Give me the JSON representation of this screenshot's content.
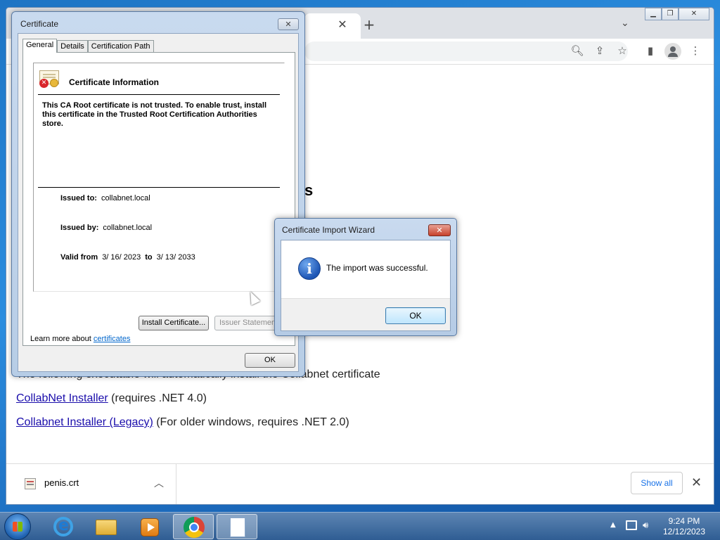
{
  "browser": {
    "page_heading_fragment": "s",
    "lines": {
      "partial_text": "The following executable will automatically install the Collabnet certificate",
      "installer_link": "CollabNet Installer",
      "installer_note": " (requires .NET 4.0)",
      "legacy_link": "Collabnet Installer (Legacy)",
      "legacy_note": " (For older windows, requires .NET 2.0)"
    },
    "download_bar": {
      "file_name": "penis.crt",
      "show_all": "Show all"
    }
  },
  "cert_dialog": {
    "title": "Certificate",
    "tabs": [
      "General",
      "Details",
      "Certification Path"
    ],
    "info_title": "Certificate Information",
    "message": "This CA Root certificate is not trusted. To enable trust, install this certificate in the Trusted Root Certification Authorities store.",
    "issued_to_label": "Issued to:",
    "issued_to": "collabnet.local",
    "issued_by_label": "Issued by:",
    "issued_by": "collabnet.local",
    "valid_from_label": "Valid from",
    "valid_from": "3/ 16/ 2023",
    "to_label": "to",
    "valid_to": "3/ 13/ 2033",
    "install_button": "Install Certificate...",
    "issuer_button": "Issuer Statement",
    "learn_more_prefix": "Learn more about ",
    "learn_more_link": "certificates",
    "ok_button": "OK"
  },
  "wizard": {
    "title": "Certificate Import Wizard",
    "message": "The import was successful.",
    "ok_button": "OK"
  },
  "taskbar": {
    "time": "9:24 PM",
    "date": "12/12/2023"
  }
}
